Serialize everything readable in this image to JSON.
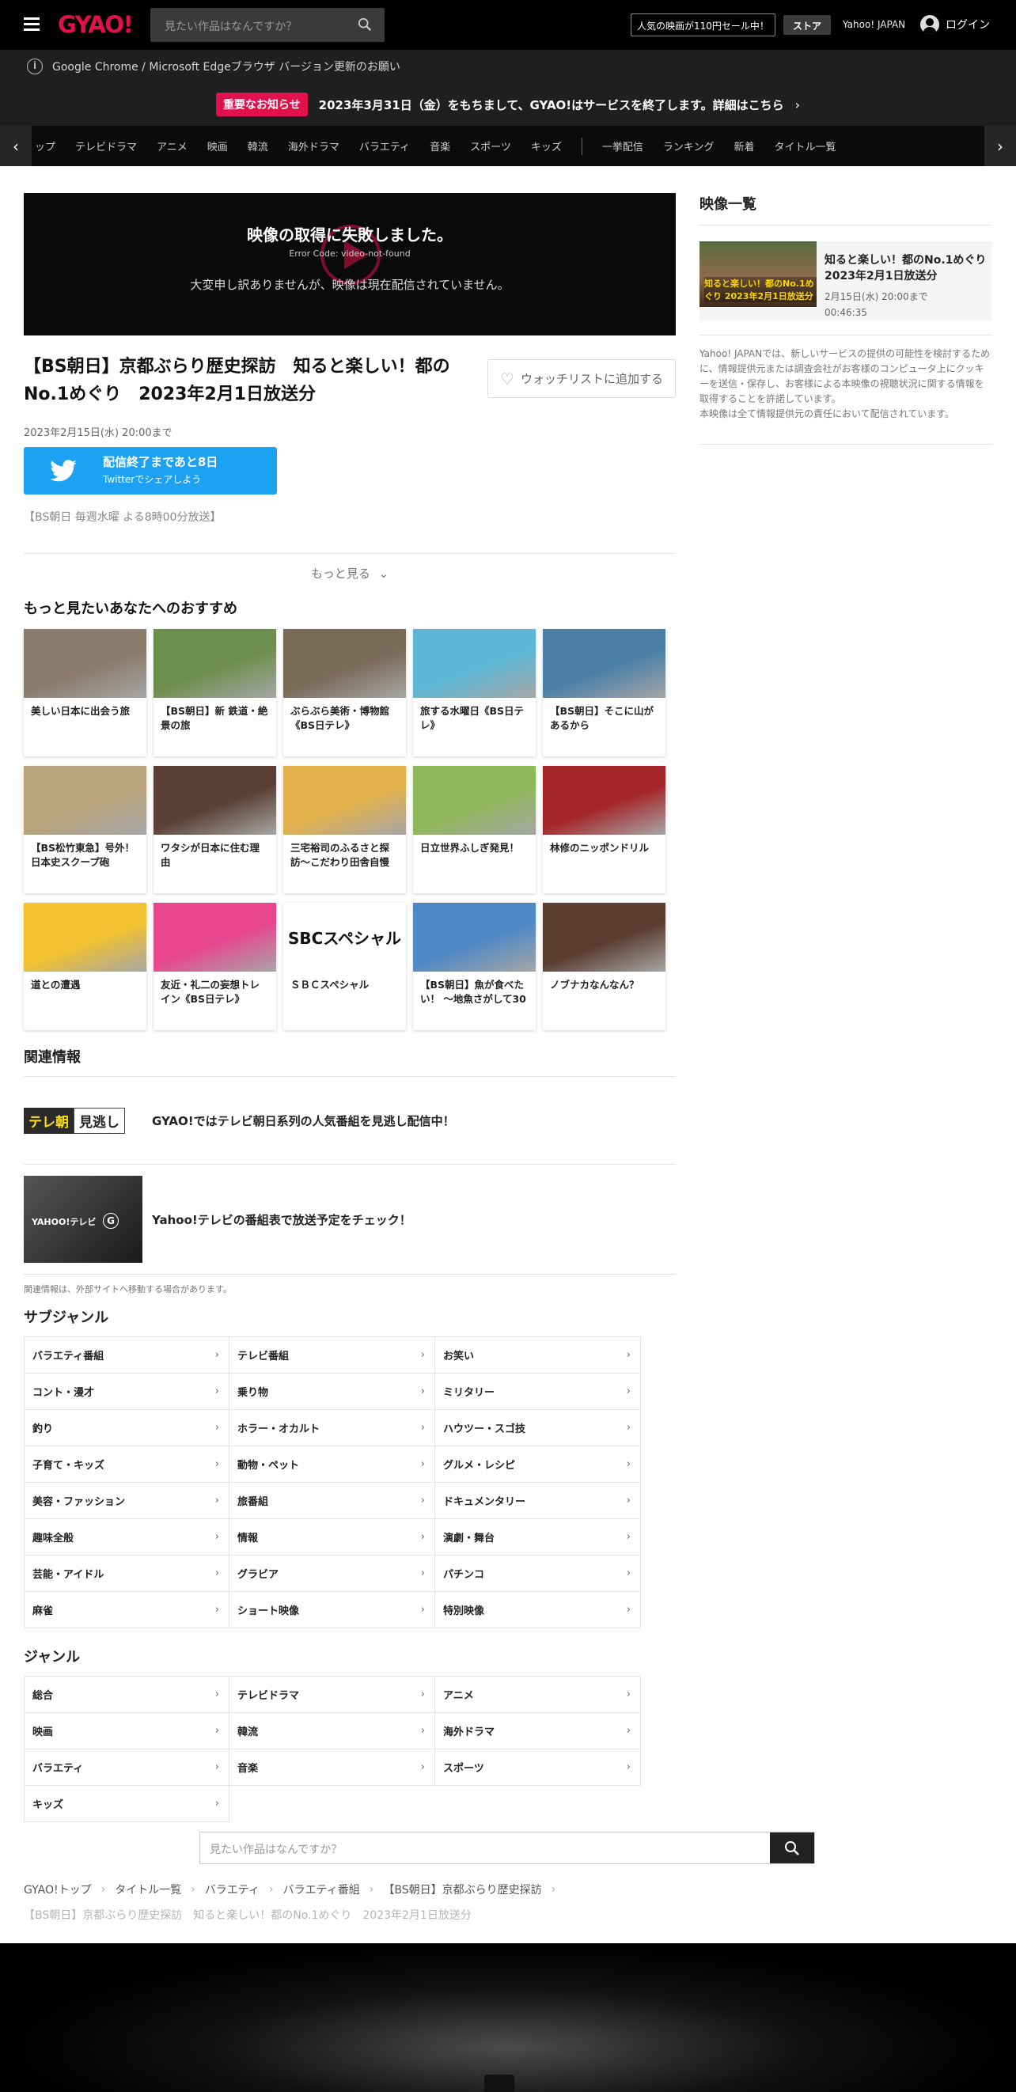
{
  "header": {
    "logo": "GYAO!",
    "search_placeholder": "見たい作品はなんですか？",
    "promo": "人気の映画が110円セール中！",
    "store": "ストア",
    "yahoo": "Yahoo! JAPAN",
    "login": "ログイン"
  },
  "notice_browser": "Google Chrome / Microsoft Edgeブラウザ バージョン更新のお願い",
  "notice_important": {
    "badge": "重要なお知らせ",
    "text": "2023年3月31日（金）をもちまして、GYAO!はサービスを終了します。詳細はこちら"
  },
  "nav": {
    "items": [
      "ップ",
      "テレビドラマ",
      "アニメ",
      "映画",
      "韓流",
      "海外ドラマ",
      "バラエティ",
      "音楽",
      "スポーツ",
      "キッズ"
    ],
    "items2": [
      "一挙配信",
      "ランキング",
      "新着",
      "タイトル一覧"
    ]
  },
  "player": {
    "error_title": "映像の取得に失敗しました。",
    "error_code": "Error Code: video-not-found",
    "error_message": "大変申し訳ありませんが、映像は現在配信されていません。"
  },
  "program": {
    "title": "【BS朝日】京都ぶらり歴史探訪　知ると楽しい！都のNo.1めぐり　2023年2月1日放送分",
    "watchlist": "ウォッチリストに追加する",
    "deadline": "2023年2月15日(水) 20:00まで",
    "remaining": "配信終了まであと8日",
    "share": "Twitterでシェアしよう",
    "broadcast": "【BS朝日 毎週水曜 よる8時00分放送】",
    "more": "もっと見る"
  },
  "recommend": {
    "heading": "もっと見たいあなたへのおすすめ",
    "items": [
      {
        "title": "美しい日本に出会う旅",
        "color": "#8a7b6a"
      },
      {
        "title": "【BS朝日】新 鉄道・絶景の旅",
        "color": "#6d8f4e"
      },
      {
        "title": "ぶらぶら美術・博物館《BS日テレ》",
        "color": "#7a6a58"
      },
      {
        "title": "旅する水曜日《BS日テレ》",
        "color": "#5cb7d6"
      },
      {
        "title": "【BS朝日】そこに山があるから",
        "color": "#4a7fa8"
      },
      {
        "title": "【BS松竹東急】号外！日本史スクープ砲",
        "color": "#b9a37c"
      },
      {
        "title": "ワタシが日本に住む理由",
        "color": "#5a4034"
      },
      {
        "title": "三宅裕司のふるさと探訪～こだわり田舎自慢",
        "color": "#e3b14c"
      },
      {
        "title": "日立世界ふしぎ発見！",
        "color": "#8fb85a"
      },
      {
        "title": "林修のニッポンドリル",
        "color": "#a5262a"
      },
      {
        "title": "道との遭遇",
        "color": "#f2c230"
      },
      {
        "title": "友近・礼二の妄想トレイン《BS日テレ》",
        "color": "#e8478f"
      },
      {
        "title": "ＳＢＣスペシャル",
        "color": "#ffffff",
        "logo": "SBCスペシャル"
      },
      {
        "title": "【BS朝日】魚が食べたい！ ～地魚さがして30",
        "color": "#4f88c6"
      },
      {
        "title": "ノブナカなんなん？",
        "color": "#5a3d2f"
      }
    ]
  },
  "related": {
    "heading": "関連情報",
    "items": [
      {
        "title": "GYAO!ではテレビ朝日系列の人気番組を見逃し配信中！",
        "logo1": "テレ朝",
        "logo2": "見逃し"
      },
      {
        "title": "Yahoo!テレビの番組表で放送予定をチェック！",
        "logo1": "YAHOO!テレビ",
        "logo2": "G"
      }
    ],
    "note": "関連情報は、外部サイトへ移動する場合があります。"
  },
  "subgenre": {
    "heading": "サブジャンル",
    "items": [
      "バラエティ番組",
      "テレビ番組",
      "お笑い",
      "コント・漫才",
      "乗り物",
      "ミリタリー",
      "釣り",
      "ホラー・オカルト",
      "ハウツー・スゴ技",
      "子育て・キッズ",
      "動物・ペット",
      "グルメ・レシピ",
      "美容・ファッション",
      "旅番組",
      "ドキュメンタリー",
      "趣味全般",
      "情報",
      "演劇・舞台",
      "芸能・アイドル",
      "グラビア",
      "パチンコ",
      "麻雀",
      "ショート映像",
      "特別映像"
    ]
  },
  "genre": {
    "heading": "ジャンル",
    "items": [
      "総合",
      "テレビドラマ",
      "アニメ",
      "映画",
      "韓流",
      "海外ドラマ",
      "バラエティ",
      "音楽",
      "スポーツ",
      "キッズ"
    ]
  },
  "bottom_search_placeholder": "見たい作品はなんですか？",
  "breadcrumb": [
    "GYAO!トップ",
    "タイトル一覧",
    "バラエティ",
    "バラエティ番組",
    "【BS朝日】京都ぶらり歴史探訪"
  ],
  "breadcrumb_current": "【BS朝日】京都ぶらり歴史探訪　知ると楽しい！都のNo.1めぐり　2023年2月1日放送分",
  "sidebar": {
    "heading": "映像一覧",
    "video": {
      "title": "知ると楽しい！都のNo.1めぐり 2023年2月1日放送分",
      "until": "2月15日(水) 20:00まで",
      "duration": "00:46:35"
    },
    "note": "Yahoo! JAPANでは、新しいサービスの提供の可能性を検討するために、情報提供元または調査会社がお客様のコンピュータ上にクッキーを送信・保存し、お客様による本映像の視聴状況に関する情報を取得することを許諾しています。\n本映像は全て情報提供元の責任において配信されています。"
  },
  "colors": {
    "accent": "#e1114e",
    "twitter": "#1da1f2"
  }
}
